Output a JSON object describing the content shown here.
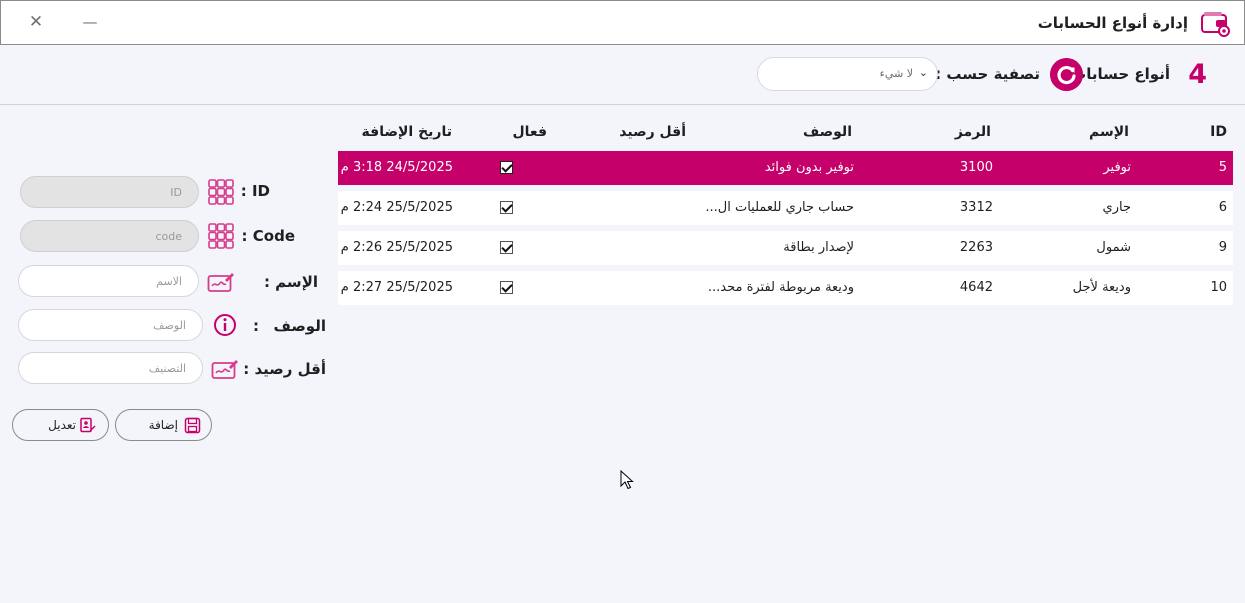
{
  "window": {
    "title": "إدارة أنواع الحسابات",
    "close_glyph": "✕",
    "minimize_glyph": "—",
    "icon": "wallet-gear-icon"
  },
  "toolbar": {
    "count": "4",
    "section_title": "أنواع حسابات",
    "refresh_icon": "refresh-icon",
    "filter_label": "تصفية حسب :",
    "filter_value": "لا شيء",
    "filter_chevron": "⌄"
  },
  "grid": {
    "columns": {
      "id": "ID",
      "name": "الإسم",
      "code": "الرمز",
      "desc": "الوصف",
      "minbal": "أقل رصيد",
      "active": "فعال",
      "date": "تاريخ الإضافة"
    },
    "rows": [
      {
        "id": "5",
        "name": "توفير",
        "code": "3100",
        "desc": "توفير بدون فوائد",
        "minbal": "",
        "active": true,
        "date": "24/5/2025 3:18 م",
        "selected": true
      },
      {
        "id": "6",
        "name": "جاري",
        "code": "3312",
        "desc": "حساب جاري للعمليات ال...",
        "minbal": "",
        "active": true,
        "date": "25/5/2025 2:24 م",
        "selected": false
      },
      {
        "id": "9",
        "name": "شمول",
        "code": "2263",
        "desc": "لإصدار بطاقة",
        "minbal": "",
        "active": true,
        "date": "25/5/2025 2:26 م",
        "selected": false
      },
      {
        "id": "10",
        "name": "وديعة لأجل",
        "code": "4642",
        "desc": "وديعة مربوطة لفترة محد...",
        "minbal": "",
        "active": true,
        "date": "25/5/2025 2:27 م",
        "selected": false
      }
    ]
  },
  "form": {
    "id": {
      "label": "ID :",
      "placeholder": "ID"
    },
    "code": {
      "label": "Code :",
      "placeholder": "code"
    },
    "name": {
      "label": "الإسم :",
      "placeholder": "الاسم"
    },
    "desc": {
      "label": "الوصف",
      "colon": ":",
      "placeholder": "الوصف"
    },
    "minbal": {
      "label": "أقل رصيد :",
      "placeholder": "التصنيف"
    },
    "add_label": "إضافة",
    "edit_label": "تعديل"
  },
  "colors": {
    "accent": "#c5006a",
    "background": "#f3f5fa"
  }
}
